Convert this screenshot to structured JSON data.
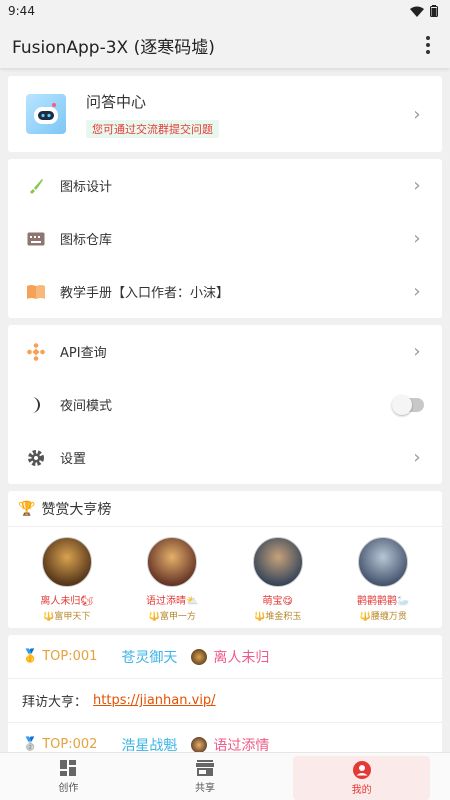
{
  "status": {
    "time": "9:44"
  },
  "app": {
    "title": "FusionApp-3X (逐寒码墟)"
  },
  "qa": {
    "title": "问答中心",
    "subtitle": "您可通过交流群提交问题"
  },
  "group1": [
    {
      "label": "图标设计",
      "icon": "brush-icon"
    },
    {
      "label": "图标仓库",
      "icon": "keyboard-icon"
    },
    {
      "label": "教学手册【入口作者：小沫】",
      "icon": "book-icon"
    }
  ],
  "group2": [
    {
      "label": "API查询",
      "icon": "api-icon"
    },
    {
      "label": "夜间模式",
      "icon": "moon-icon",
      "toggle": false
    },
    {
      "label": "设置",
      "icon": "gear-icon"
    }
  ],
  "ranking": {
    "title": "赞赏大亨榜",
    "items": [
      {
        "name": "离人未归🐿",
        "title": "🔱富甲天下"
      },
      {
        "name": "语过添晴⛅",
        "title": "🔱富甲一方"
      },
      {
        "name": "萌宝😋",
        "title": "🔱堆金积玉"
      },
      {
        "name": "鹳鹳鹳鹳🦢",
        "title": "🔱腰缠万贯"
      }
    ]
  },
  "top": [
    {
      "medal": "🥇",
      "id": "TOP:001",
      "name": "苍灵御天",
      "user": "离人未归"
    },
    {
      "medal": "🥈",
      "id": "TOP:002",
      "name": "浩星战魁",
      "user": "语过添情"
    }
  ],
  "visit": {
    "label": "拜访大亨：",
    "link": "https://jianhan.vip/"
  },
  "nav": {
    "create": "创作",
    "share": "共享",
    "mine": "我的"
  },
  "colors": {
    "accent": "#e53935",
    "link": "#e65100",
    "gold": "#e6a23c",
    "blue": "#3bb4e8",
    "pink": "#ef5b88"
  }
}
